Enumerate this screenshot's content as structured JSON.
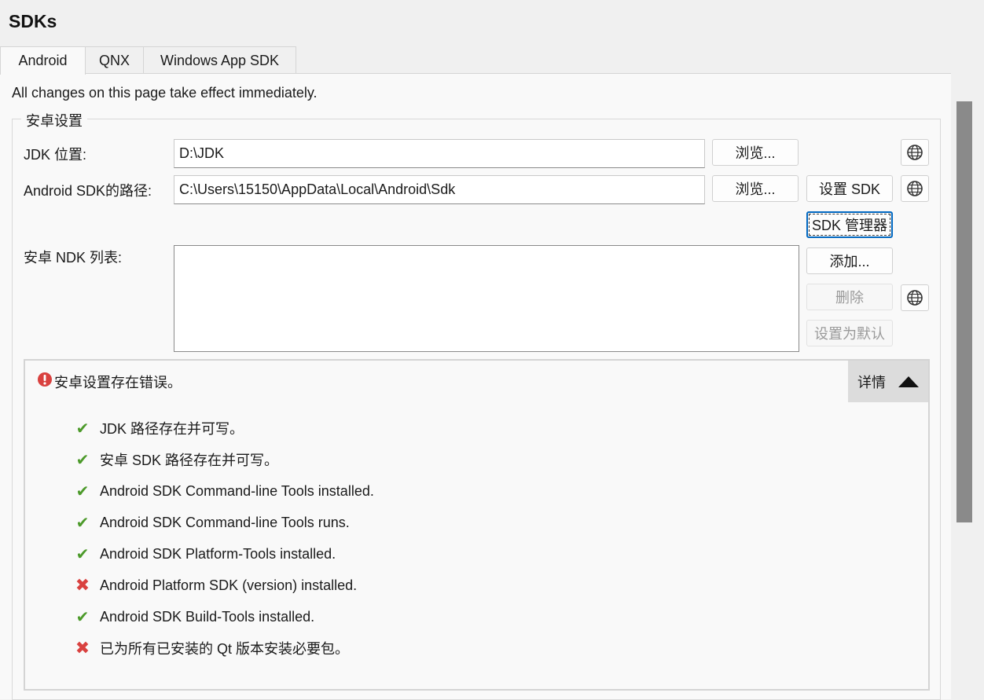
{
  "title": "SDKs",
  "tabs": [
    {
      "label": "Android"
    },
    {
      "label": "QNX"
    },
    {
      "label": "Windows App SDK"
    }
  ],
  "notice": "All changes on this page take effect immediately.",
  "group": {
    "title": "安卓设置",
    "jdk": {
      "label": "JDK 位置:",
      "value": "D:\\JDK",
      "browse": "浏览..."
    },
    "sdk": {
      "label": "Android SDK的路径:",
      "value": "C:\\Users\\15150\\AppData\\Local\\Android\\Sdk",
      "browse": "浏览...",
      "setup": "设置 SDK"
    },
    "sdk_manager": "SDK 管理器",
    "ndk": {
      "label": "安卓 NDK 列表:",
      "add": "添加...",
      "remove": "删除",
      "make_default": "设置为默认"
    }
  },
  "status": {
    "summary": "安卓设置存在错误。",
    "details_label": "详情",
    "items": [
      {
        "ok": true,
        "text": "JDK 路径存在并可写。"
      },
      {
        "ok": true,
        "text": "安卓 SDK 路径存在并可写。"
      },
      {
        "ok": true,
        "text": "Android SDK Command-line Tools installed."
      },
      {
        "ok": true,
        "text": "Android SDK Command-line Tools runs."
      },
      {
        "ok": true,
        "text": "Android SDK Platform-Tools installed."
      },
      {
        "ok": false,
        "text": "Android Platform SDK (version) installed."
      },
      {
        "ok": true,
        "text": "Android SDK Build-Tools installed."
      },
      {
        "ok": false,
        "text": "已为所有已安装的 Qt 版本安装必要包。"
      }
    ]
  },
  "colors": {
    "ok": "#4c9a2a",
    "error": "#d9413f",
    "accent": "#0067c0"
  },
  "icons": {
    "globe": "globe-icon",
    "ok": "check-icon",
    "error": "cross-icon",
    "summary": "error-icon",
    "details": "triangle-up-icon"
  }
}
